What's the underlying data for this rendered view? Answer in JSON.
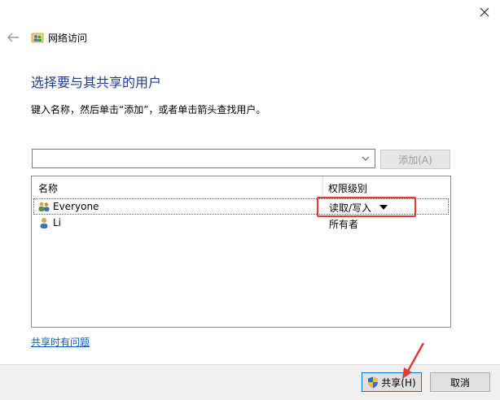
{
  "window": {
    "close_icon": "close-icon",
    "back_icon": "back-arrow-icon"
  },
  "header": {
    "title": "网络访问",
    "icon": "network-users-icon"
  },
  "main": {
    "heading": "选择要与其共享的用户",
    "instruction": "键入名称，然后单击“添加”，或者单击箭头查找用户。"
  },
  "user_input": {
    "value": "",
    "add_label": "添加(A)"
  },
  "list": {
    "columns": [
      "名称",
      "权限级别"
    ],
    "rows": [
      {
        "name": "Everyone",
        "permission": "读取/写入",
        "icon": "group-users-icon"
      },
      {
        "name": "Li",
        "permission": "所有者",
        "icon": "user-icon"
      }
    ]
  },
  "help_link": "共享时有问题",
  "footer": {
    "share_label": "共享(H)",
    "cancel_label": "取消",
    "shield_icon": "uac-shield-icon"
  },
  "colors": {
    "heading": "#1e3d8f",
    "link": "#0a5bc4",
    "highlight": "#e53935",
    "primary_border": "#0078d7"
  }
}
